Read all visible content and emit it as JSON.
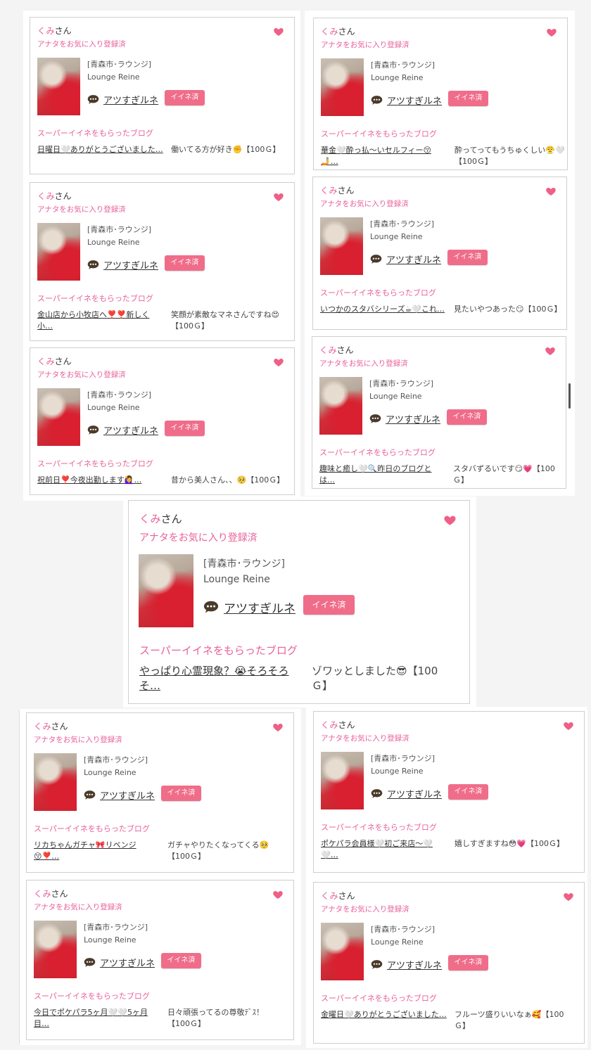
{
  "colors": {
    "accent": "#e8619a",
    "badge": "#f06d8a"
  },
  "icons": {
    "heart": "heart-icon",
    "chat": "chat-bubble-icon"
  },
  "common": {
    "name": "くみ",
    "suffix": "さん",
    "fav": "アナタをお気に入り登録済",
    "area": "[青森市･ラウンジ]",
    "shop": "Lounge Reine",
    "person": "アツすぎルネ",
    "badge": "イイネ済",
    "sec": "スーパーイイネをもらったブログ"
  },
  "cards": [
    {
      "blog": "日曜日🤍ありがとうございました…",
      "comment": "働いてる方が好き✊【100Ｇ】"
    },
    {
      "blog": "金山店から小牧店へ❣️❣️新しく小…",
      "comment": "笑顔が素敵なマネさんですね😍【100Ｇ】"
    },
    {
      "blog": "祝前日❣️今夜出勤します🙋‍♀️…",
      "comment": "昔から美人さん、、🥺【100Ｇ】"
    },
    {
      "blog": "華金🤍酔っ払〜いセルフィー😚🤳…",
      "comment": "酔ってってもうちゅくしい😤🤍【100Ｇ】"
    },
    {
      "blog": "いつかのスタバシリーズ☕🤍これ…",
      "comment": "見たいやつあった😏【100Ｇ】"
    },
    {
      "blog": "趣味と癒し🤍🔍昨日のブログとは…",
      "comment": "スタバずるいです😏💗【100Ｇ】"
    },
    {
      "blog": "やっぱり心霊現象？😭そろそろそ…",
      "comment": "ゾワッとしました😎【100Ｇ】"
    },
    {
      "blog": "リカちゃんガチャ🎀リベンジ😚❣️…",
      "comment": "ガチャやりたくなってくる🥺【100Ｇ】"
    },
    {
      "blog": "ポケパラ会員様🤍初ご来店〜🤍🤍…",
      "comment": "嬉しすぎますね😳💗【100Ｇ】"
    },
    {
      "blog": "今日でポケパラ5ヶ月🤍🤍5ヶ月目…",
      "comment": "日々頑張ってるの尊敬ﾃﾞｽ！【100Ｇ】"
    },
    {
      "blog": "金曜日🤍ありがとうございました…",
      "comment": "フルーツ盛りいいなぁ🥰【100Ｇ】"
    }
  ]
}
